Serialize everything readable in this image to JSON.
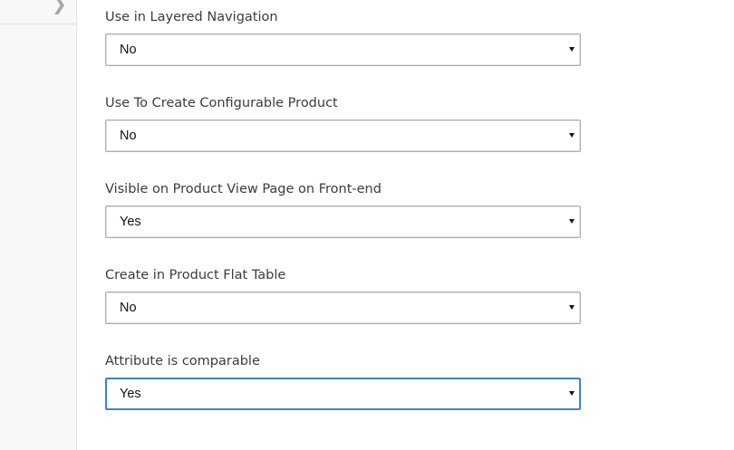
{
  "sidebar": {
    "toggle_icon": "chevron-right-icon"
  },
  "fields": [
    {
      "label": "Use in Layered Navigation",
      "value": "No"
    },
    {
      "label": "Use To Create Configurable Product",
      "value": "No"
    },
    {
      "label": "Visible on Product View Page on Front-end",
      "value": "Yes"
    },
    {
      "label": "Create in Product Flat Table",
      "value": "No"
    },
    {
      "label": "Attribute is comparable",
      "value": "Yes",
      "focused": true
    }
  ],
  "colors": {
    "focus_border": "#3b84c9",
    "select_border": "#adadad",
    "label_text": "#3c3c3c"
  }
}
